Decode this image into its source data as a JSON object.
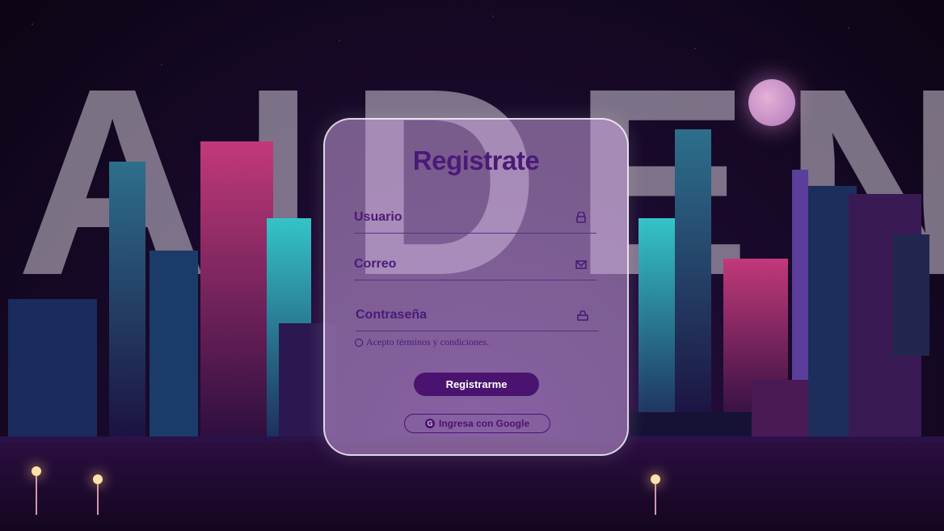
{
  "background": {
    "brand_text": "AIDEN"
  },
  "form": {
    "title": "Registrate",
    "fields": [
      {
        "label": "Usuario",
        "icon": "user-icon"
      },
      {
        "label": "Correo",
        "icon": "mail-icon"
      },
      {
        "label": "Contraseña",
        "icon": "lock-icon"
      }
    ],
    "terms_label": "Acepto términos y condiciones.",
    "submit_label": "Registrarme",
    "google_label": "Ingresa con Google"
  },
  "colors": {
    "accent": "#4a1370",
    "text": "#4a1a78"
  }
}
